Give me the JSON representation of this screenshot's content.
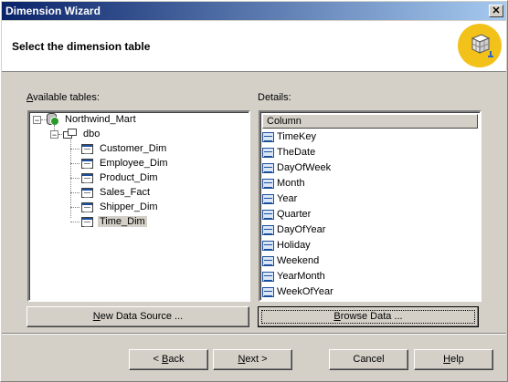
{
  "window": {
    "title": "Dimension Wizard",
    "close_glyph": "✕"
  },
  "header": {
    "heading": "Select the dimension table",
    "icon": "cube-wizard-icon"
  },
  "available": {
    "label_pre": "",
    "label_u": "A",
    "label_post": "vailable tables:",
    "root": "Northwind_Mart",
    "schema": "dbo",
    "tables": [
      "Customer_Dim",
      "Employee_Dim",
      "Product_Dim",
      "Sales_Fact",
      "Shipper_Dim",
      "Time_Dim"
    ],
    "selected": "Time_Dim"
  },
  "details": {
    "label": "Details:",
    "column_header": "Column",
    "columns": [
      "TimeKey",
      "TheDate",
      "DayOfWeek",
      "Month",
      "Year",
      "Quarter",
      "DayOfYear",
      "Holiday",
      "Weekend",
      "YearMonth",
      "WeekOfYear"
    ]
  },
  "buttons": {
    "new_ds_pre": "",
    "new_ds_u": "N",
    "new_ds_post": "ew Data Source ...",
    "browse_pre": "",
    "browse_u": "B",
    "browse_post": "rowse Data ...",
    "back_pre": "< ",
    "back_u": "B",
    "back_post": "ack",
    "next_pre": "",
    "next_u": "N",
    "next_post": "ext >",
    "cancel": "Cancel",
    "help_pre": "",
    "help_u": "H",
    "help_post": "elp"
  },
  "colors": {
    "title_start": "#0a246a",
    "title_end": "#a6caf0",
    "face": "#d4d0c8",
    "icon_bg": "#f2c21b"
  }
}
